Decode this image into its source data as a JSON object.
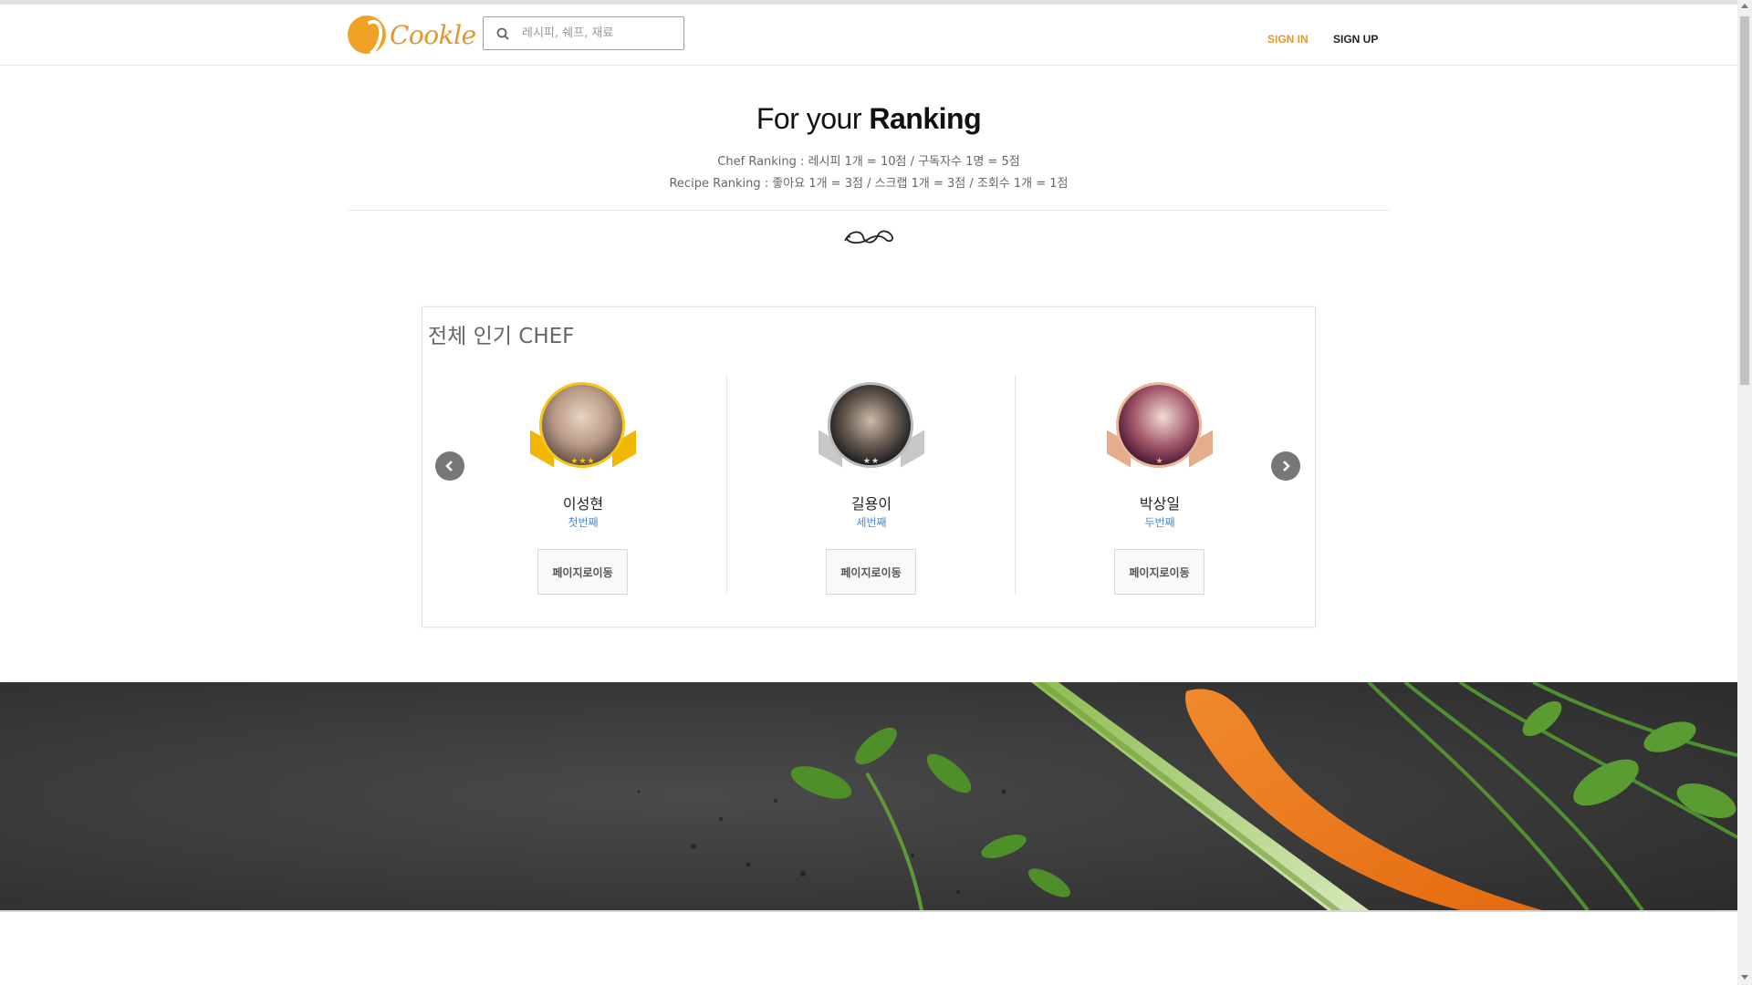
{
  "header": {
    "logo_text": "Cookle",
    "search_placeholder": "레시피, 쉐프, 재료",
    "sign_in": "SIGN IN",
    "sign_up": "SIGN UP"
  },
  "title": {
    "prefix": "For your",
    "bold": "Ranking",
    "line1": "Chef Ranking : 레시피 1개 = 10점 / 구독자수 1명 = 5점",
    "line2": "Recipe Ranking : 좋아요 1개 = 3점 / 스크랩 1개 = 3점 / 조회수 1개 = 1점"
  },
  "ranking": {
    "title": "전체 인기 CHEF",
    "chefs": [
      {
        "name": "이성현",
        "rank": "첫번째",
        "button": "페이지로이동",
        "medal": "gold",
        "ring": "#f5c518",
        "ribbon": "#f2b705"
      },
      {
        "name": "길용이",
        "rank": "세번째",
        "button": "페이지로이동",
        "medal": "silver",
        "ring": "#b9b9b9",
        "ribbon": "#c8c8c8"
      },
      {
        "name": "박상일",
        "rank": "두번째",
        "button": "페이지로이동",
        "medal": "bronze",
        "ring": "#e8b79a",
        "ribbon": "#e6ad8c"
      }
    ]
  },
  "icons": {
    "search": "search-icon",
    "prev": "chevron-left-icon",
    "next": "chevron-right-icon"
  },
  "colors": {
    "accent": "#e4962a",
    "rank_link": "#4a8ad6"
  }
}
